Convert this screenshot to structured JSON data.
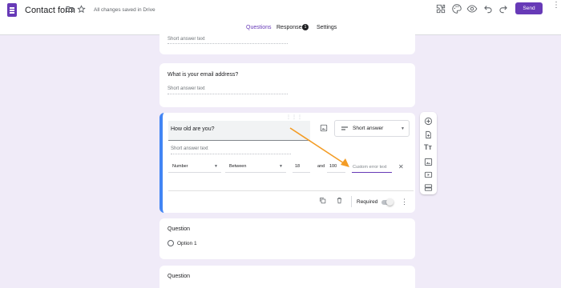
{
  "header": {
    "title": "Contact form",
    "saved_status": "All changes saved in Drive",
    "send_label": "Send",
    "tabs": [
      {
        "label": "Questions",
        "active": true
      },
      {
        "label": "Responses",
        "badge": "1"
      },
      {
        "label": "Settings"
      }
    ]
  },
  "questions": [
    {
      "title": "",
      "answer_placeholder": "Short answer text"
    },
    {
      "title": "What is your email address?",
      "answer_placeholder": "Short answer text"
    },
    {
      "title": "How old are you?",
      "answer_placeholder": "Short answer text",
      "type": "Short answer",
      "validation": {
        "kind": "Number",
        "condition": "Between",
        "min": "18",
        "joiner": "and",
        "max": "100",
        "error_placeholder": "Custom error text"
      },
      "required_label": "Required",
      "required": false
    },
    {
      "title": "Question",
      "option": "Option 1"
    },
    {
      "title": "Question"
    }
  ],
  "side_toolbar": [
    "add-question-icon",
    "import-questions-icon",
    "add-title-icon",
    "add-image-icon",
    "add-video-icon",
    "add-section-icon"
  ],
  "colors": {
    "accent": "#673ab7",
    "active_border": "#4285f4",
    "background": "#f0ebf8",
    "annotation_arrow": "#f39c25"
  }
}
